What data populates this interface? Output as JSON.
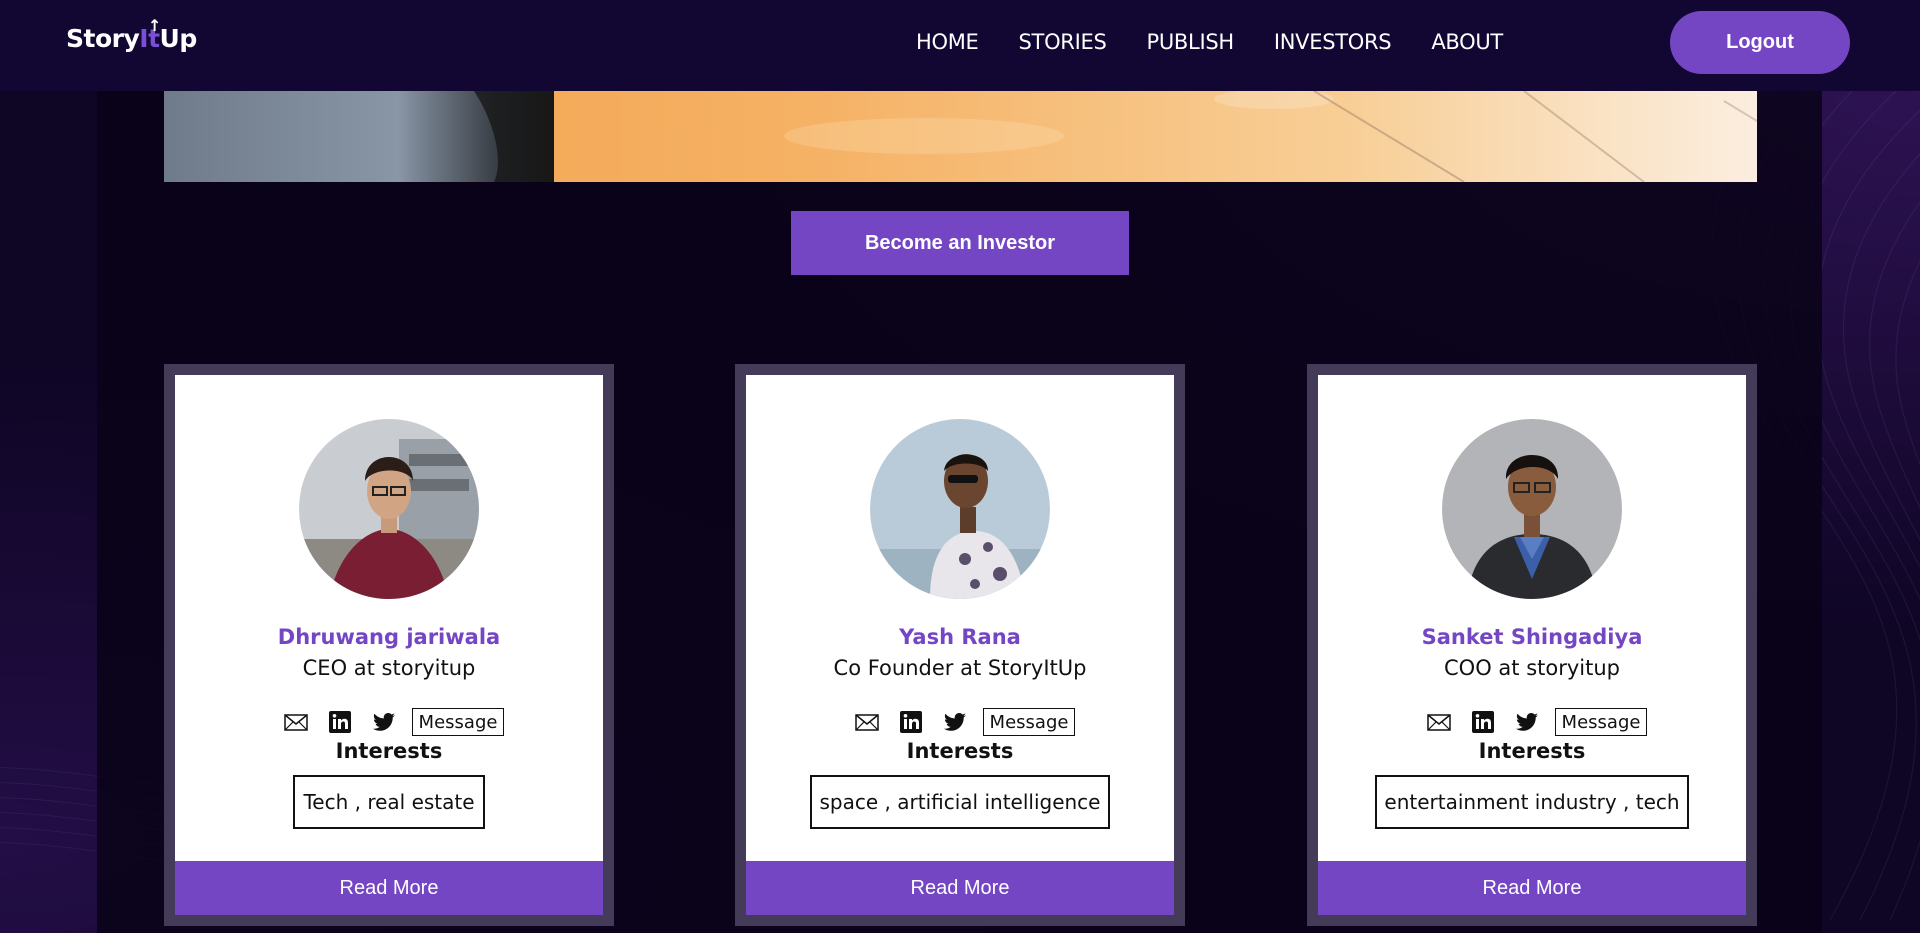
{
  "navbar": {
    "logo": {
      "part1": "Story",
      "part2": "It",
      "part3": "Up"
    },
    "links": [
      "HOME",
      "STORIES",
      "PUBLISH",
      "INVESTORS",
      "ABOUT"
    ],
    "logout_label": "Logout"
  },
  "main": {
    "become_investor_label": "Become an Investor"
  },
  "cards": [
    {
      "name": "Dhruwang jariwala",
      "role": "CEO at storyitup",
      "message_label": "Message",
      "interests_title": "Interests",
      "interests": "Tech , real estate",
      "read_more_label": "Read More"
    },
    {
      "name": "Yash Rana",
      "role": "Co Founder at StoryItUp",
      "message_label": "Message",
      "interests_title": "Interests",
      "interests": "space , artificial intelligence",
      "read_more_label": "Read More"
    },
    {
      "name": "Sanket Shingadiya",
      "role": "COO at storyitup",
      "message_label": "Message",
      "interests_title": "Interests",
      "interests": "entertainment industry , tech",
      "read_more_label": "Read More"
    }
  ],
  "colors": {
    "accent": "#7446c4",
    "navbar_bg": "#120633",
    "page_bg": "#0f0525",
    "card_border": "#433b57"
  }
}
